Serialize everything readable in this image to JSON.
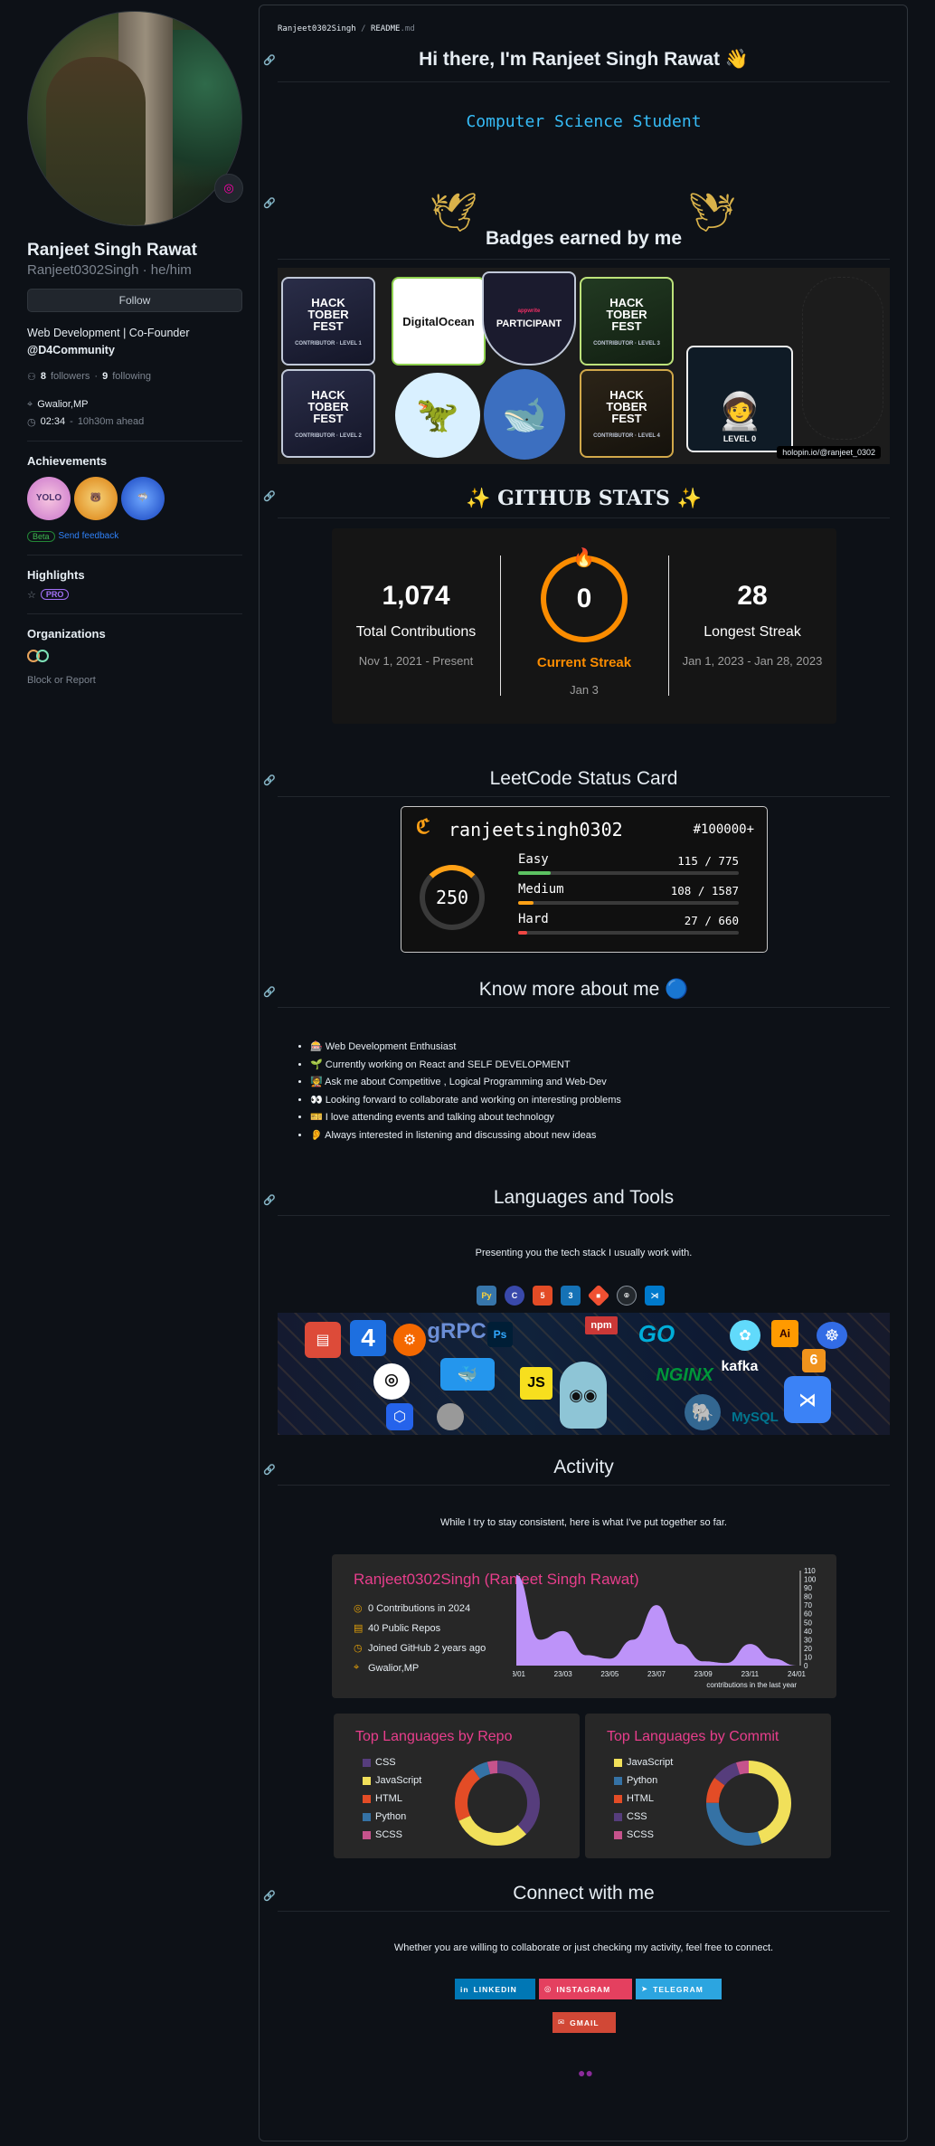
{
  "profile": {
    "name": "Ranjeet Singh Rawat",
    "login": "Ranjeet0302Singh",
    "pronouns": "he/him",
    "follow_label": "Follow",
    "bio": "Web Development | Co-Founder",
    "company": "@D4Community",
    "followers": "8",
    "followers_label": "followers",
    "following": "9",
    "following_label": "following",
    "location": "Gwalior,MP",
    "local_time": "02:34",
    "time_offset": "10h30m ahead",
    "achievements_title": "Achievements",
    "beta": "Beta",
    "send_feedback": "Send feedback",
    "highlights_title": "Highlights",
    "pro": "PRO",
    "organizations_title": "Organizations",
    "block_report": "Block or Report"
  },
  "readme": {
    "owner": "Ranjeet0302Singh",
    "file": "README",
    "ext": ".md",
    "greeting": "Hi there, I'm Ranjeet Singh Rawat 👋",
    "typing_line": "Computer Science Student",
    "badges_title": "Badges earned by me",
    "badges": [
      {
        "title": "HACK\nTOBER\nFEST",
        "sub": "CONTRIBUTOR · LEVEL 1"
      },
      {
        "title": "DigitalOcean",
        "sub": ""
      },
      {
        "title": "PARTICIPANT",
        "sub": "appwrite"
      },
      {
        "title": "HACK\nTOBER\nFEST",
        "sub": "CONTRIBUTOR · LEVEL 3"
      },
      {
        "title": "HACK\nTOBER\nFEST",
        "sub": "CONTRIBUTOR · LEVEL 2"
      },
      {
        "title": "HACK\nTOBER\nFEST",
        "sub": "CONTRIBUTOR · LEVEL 4"
      },
      {
        "title": "LEVEL 0",
        "sub": ""
      }
    ],
    "holopin_link": "holopin.io/@ranjeet_0302",
    "stats_title": "GITHUB STATS",
    "stats": {
      "total": "1,074",
      "total_label": "Total Contributions",
      "total_range": "Nov 1, 2021 - Present",
      "current": "0",
      "current_label": "Current Streak",
      "current_date": "Jan 3",
      "longest": "28",
      "longest_label": "Longest Streak",
      "longest_range": "Jan 1, 2023 - Jan 28, 2023",
      "accent": "#fb8c00"
    },
    "leetcode_title": "LeetCode Status Card",
    "leetcode": {
      "username": "ranjeetsingh0302",
      "rank": "#100000+",
      "solved": "250",
      "easy_label": "Easy",
      "easy": "115 / 775",
      "easy_frac": 0.148,
      "medium_label": "Medium",
      "medium": "108 / 1587",
      "medium_frac": 0.068,
      "hard_label": "Hard",
      "hard": "27 / 660",
      "hard_frac": 0.041
    },
    "know_title": "Know more about me 🔵",
    "know_items": [
      "🎰 Web Development Enthusiast",
      "🌱 Currently working on React and SELF DEVELOPMENT",
      "🧑‍🏫 Ask me about Competitive , Logical Programming and Web-Dev",
      "👀 Looking forward to collaborate and working on interesting problems",
      "🎫 I love attending events and talking about technology",
      "👂 Always interested in listening and discussing about new ideas"
    ],
    "tools_title": "Languages and Tools",
    "tools_subtitle": "Presenting you the tech stack I usually work with.",
    "tool_icons": [
      "python-icon",
      "c-icon",
      "html5-icon",
      "css3-icon",
      "git-icon",
      "github-icon",
      "vscode-icon"
    ],
    "activity_title": "Activity",
    "activity_subtitle": "While I try to stay consistent, here is what I've put together so far.",
    "activity_card": {
      "title": "Ranjeet0302Singh (Ranjeet Singh Rawat)",
      "contributions": "0 Contributions in 2024",
      "repos": "40 Public Repos",
      "joined": "Joined GitHub 2 years ago",
      "location": "Gwalior,MP",
      "graph_caption": "contributions in the last year",
      "x_ticks": [
        "23/01",
        "23/03",
        "23/05",
        "23/07",
        "23/09",
        "23/11",
        "24/01"
      ],
      "y_ticks": [
        "110",
        "100",
        "90",
        "80",
        "70",
        "60",
        "50",
        "40",
        "30",
        "20",
        "10",
        "0"
      ]
    },
    "top_repo": {
      "title": "Top Languages by Repo",
      "items": [
        {
          "name": "CSS",
          "color": "#563d7c",
          "value": 38
        },
        {
          "name": "JavaScript",
          "color": "#f1e05a",
          "value": 30
        },
        {
          "name": "HTML",
          "color": "#e34c26",
          "value": 22
        },
        {
          "name": "Python",
          "color": "#3572A5",
          "value": 6
        },
        {
          "name": "SCSS",
          "color": "#c6538c",
          "value": 4
        }
      ]
    },
    "top_commit": {
      "title": "Top Languages by Commit",
      "items": [
        {
          "name": "JavaScript",
          "color": "#f1e05a",
          "value": 45
        },
        {
          "name": "Python",
          "color": "#3572A5",
          "value": 30
        },
        {
          "name": "HTML",
          "color": "#e34c26",
          "value": 10
        },
        {
          "name": "CSS",
          "color": "#563d7c",
          "value": 10
        },
        {
          "name": "SCSS",
          "color": "#c6538c",
          "value": 5
        }
      ]
    },
    "connect_title": "Connect with me",
    "connect_subtitle": "Whether you are willing to collaborate or just checking my activity, feel free to connect.",
    "socials": {
      "linkedin": "LINKEDIN",
      "instagram": "INSTAGRAM",
      "telegram": "TELEGRAM",
      "gmail": "GMAIL"
    }
  },
  "chart_data": {
    "type": "area",
    "title": "",
    "xlabel": "contributions in the last year",
    "ylabel": "",
    "x": [
      "23/01",
      "23/02",
      "23/03",
      "23/04",
      "23/05",
      "23/06",
      "23/07",
      "23/08",
      "23/09",
      "23/10",
      "23/11",
      "23/12",
      "24/01"
    ],
    "values": [
      105,
      30,
      40,
      12,
      8,
      30,
      70,
      25,
      5,
      3,
      25,
      8,
      0
    ],
    "ylim": [
      0,
      110
    ]
  }
}
